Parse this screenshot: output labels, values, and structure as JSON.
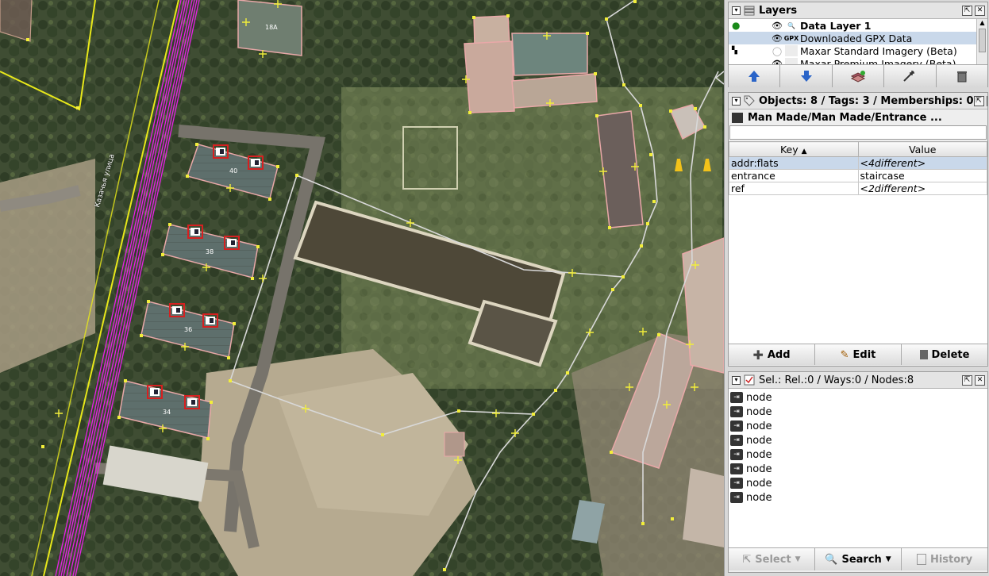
{
  "map": {
    "street_name": "Казачья улица",
    "building_numbers": [
      "18A",
      "40",
      "38",
      "36",
      "34"
    ]
  },
  "layers_panel": {
    "title": "Layers",
    "layers": [
      {
        "name": "Data Layer 1",
        "icon": "magnifier-layer-icon",
        "active": true
      },
      {
        "name": "Downloaded GPX Data",
        "icon": "gpx-icon",
        "badge": "GPX",
        "selected": true
      },
      {
        "name": "Maxar Standard Imagery (Beta)",
        "icon": "imagery-icon"
      },
      {
        "name": "Maxar Premium Imagery (Beta)",
        "icon": "imagery-icon"
      }
    ],
    "toolbar": [
      "move-up-icon",
      "move-down-icon",
      "merge-layers-icon",
      "layer-settings-icon",
      "delete-layer-icon"
    ]
  },
  "tags_panel": {
    "title": "Objects: 8 / Tags: 3 / Memberships: 0",
    "preset": "Man Made/Man Made/Entrance ...",
    "columns": [
      "Key",
      "Value"
    ],
    "rows": [
      {
        "key": "addr:flats",
        "value": "<4different>"
      },
      {
        "key": "entrance",
        "value": "staircase"
      },
      {
        "key": "ref",
        "value": "<2different>"
      }
    ],
    "buttons": {
      "add": "Add",
      "edit": "Edit",
      "delete": "Delete"
    }
  },
  "selection_panel": {
    "title": "Sel.: Rel.:0 / Ways:0 / Nodes:8",
    "items": [
      "node",
      "node",
      "node",
      "node",
      "node",
      "node",
      "node",
      "node"
    ],
    "buttons": {
      "select": "Select",
      "search": "Search",
      "history": "History"
    }
  }
}
